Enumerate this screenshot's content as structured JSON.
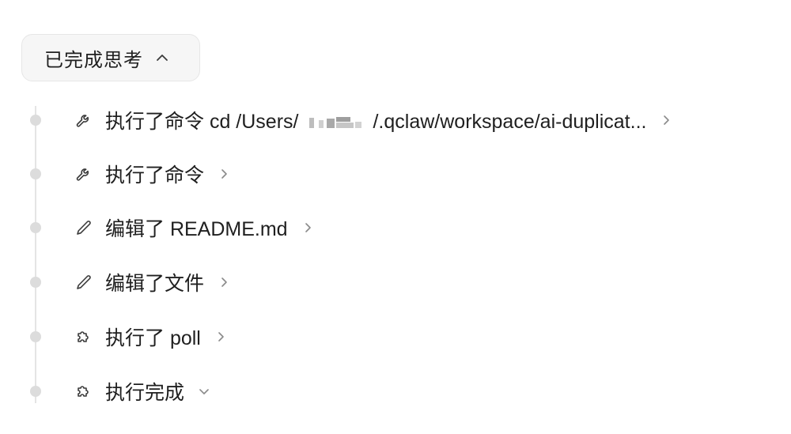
{
  "thinking": {
    "label": "已完成思考",
    "chevron_icon": "chevron-up-icon"
  },
  "steps": [
    {
      "icon": "wrench-icon",
      "label_prefix": "执行了命令 cd /Users/",
      "label_suffix": "/.qclaw/workspace/ai-duplicat...",
      "chevron_icon": "chevron-right-icon"
    },
    {
      "icon": "wrench-icon",
      "label": "执行了命令",
      "chevron_icon": "chevron-right-icon"
    },
    {
      "icon": "pencil-icon",
      "label": "编辑了 README.md",
      "chevron_icon": "chevron-right-icon"
    },
    {
      "icon": "pencil-icon",
      "label": "编辑了文件",
      "chevron_icon": "chevron-right-icon"
    },
    {
      "icon": "puzzle-icon",
      "label": "执行了 poll",
      "chevron_icon": "chevron-right-icon"
    },
    {
      "icon": "puzzle-icon",
      "label": "执行完成",
      "chevron_icon": "chevron-down-icon"
    }
  ],
  "colors": {
    "text": "#1f1f1f",
    "muted": "#8a8a8a",
    "timeline": "#e4e4e4",
    "toggle_bg": "#f6f6f6"
  }
}
